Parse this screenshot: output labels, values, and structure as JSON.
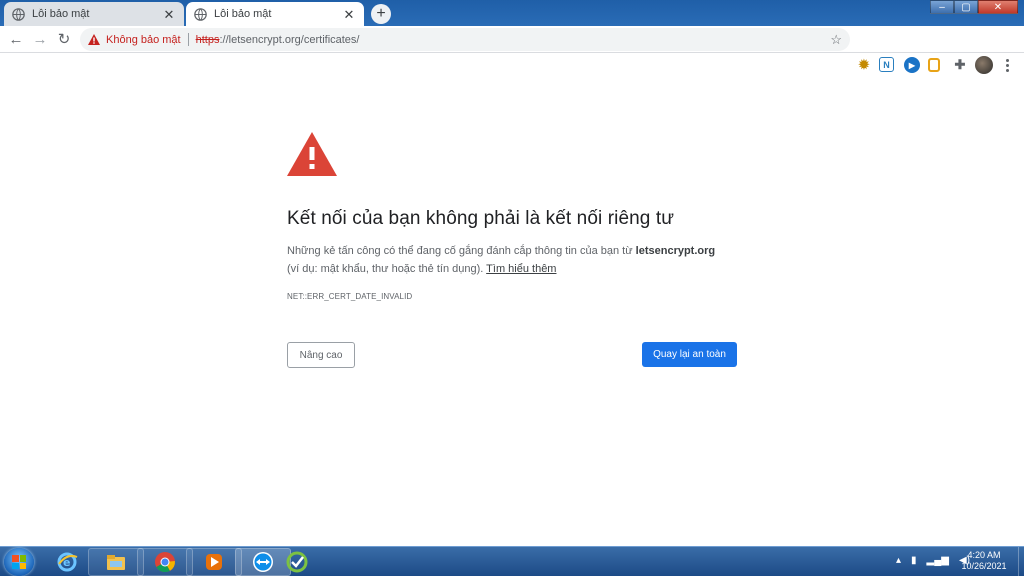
{
  "tabs": [
    {
      "title": "Lỗi bảo mật",
      "active": false
    },
    {
      "title": "Lỗi bảo mật",
      "active": true
    }
  ],
  "toolbar": {
    "security_label": "Không bảo mật",
    "url_scheme": "https",
    "url_rest": "://letsencrypt.org/certificates/"
  },
  "interstitial": {
    "heading": "Kết nối của bạn không phải là kết nối riêng tư",
    "body_prefix": "Những kẻ tấn công có thể đang cố gắng đánh cắp thông tin của bạn từ ",
    "domain": "letsencrypt.org",
    "body_suffix": "(ví dụ: mật khẩu, thư hoặc thẻ tín dụng). ",
    "learn_more": "Tìm hiểu thêm",
    "error_code": "NET::ERR_CERT_DATE_INVALID",
    "advanced_button": "Nâng cao",
    "back_button": "Quay lại an toàn"
  },
  "taskbar": {
    "time": "4:20 AM",
    "date": "10/26/2021"
  },
  "colors": {
    "danger": "#db4437",
    "primary_button": "#1a73e8",
    "not_secure": "#c5221f"
  },
  "icons": [
    "globe-icon",
    "close-icon",
    "plus-icon",
    "back-icon",
    "forward-icon",
    "reload-icon",
    "warning-icon",
    "star-icon",
    "puzzle-icon",
    "windows-start-icon",
    "ie-icon",
    "explorer-icon",
    "chrome-icon",
    "media-player-icon",
    "teamviewer-icon",
    "volume-icon"
  ]
}
